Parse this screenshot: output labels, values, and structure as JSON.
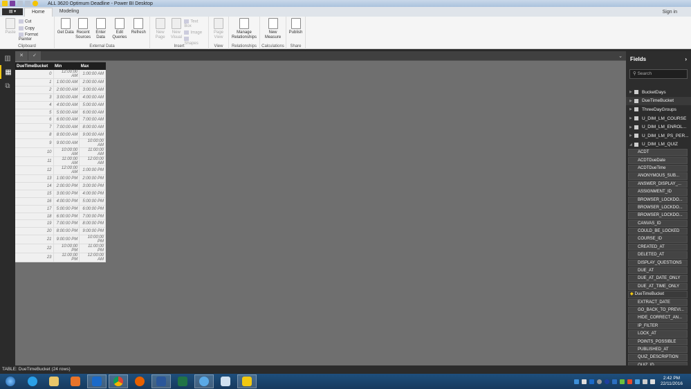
{
  "window": {
    "title": "ALL 3620 Optimum Deadline - Power BI Desktop"
  },
  "tabs": [
    {
      "label": "Home"
    },
    {
      "label": "Modeling"
    }
  ],
  "signin": "Sign in",
  "ribbon": {
    "clipboard": {
      "label": "Clipboard",
      "paste": "Paste",
      "cut": "Cut",
      "copy": "Copy",
      "format_painter": "Format Painter"
    },
    "external": {
      "label": "External Data",
      "get_data": "Get Data",
      "recent_sources": "Recent Sources",
      "enter_data": "Enter Data",
      "edit_queries": "Edit Queries",
      "refresh": "Refresh"
    },
    "insert": {
      "label": "Insert",
      "new_page": "New Page",
      "new_visual": "New Visual",
      "text_box": "Text Box",
      "image": "Image",
      "shapes": "Shapes"
    },
    "view": {
      "label": "View",
      "page_view": "Page View"
    },
    "relationships": {
      "label": "Relationships",
      "manage": "Manage Relationships"
    },
    "calculations": {
      "label": "Calculations",
      "new_measure": "New Measure"
    },
    "share": {
      "label": "Share",
      "publish": "Publish"
    }
  },
  "table": {
    "columns": [
      "DueTimeBucket",
      "Min",
      "Max"
    ],
    "rows": [
      [
        "0",
        "12:00:00 AM",
        "1:00:00 AM"
      ],
      [
        "1",
        "1:00:00 AM",
        "2:00:00 AM"
      ],
      [
        "2",
        "2:00:00 AM",
        "3:00:00 AM"
      ],
      [
        "3",
        "3:00:00 AM",
        "4:00:00 AM"
      ],
      [
        "4",
        "4:00:00 AM",
        "5:00:00 AM"
      ],
      [
        "5",
        "5:00:00 AM",
        "6:00:00 AM"
      ],
      [
        "6",
        "6:00:00 AM",
        "7:00:00 AM"
      ],
      [
        "7",
        "7:00:00 AM",
        "8:00:00 AM"
      ],
      [
        "8",
        "8:00:00 AM",
        "9:00:00 AM"
      ],
      [
        "9",
        "9:00:00 AM",
        "10:00:00 AM"
      ],
      [
        "10",
        "10:00:00 AM",
        "11:00:00 AM"
      ],
      [
        "11",
        "11:00:00 AM",
        "12:00:00 AM"
      ],
      [
        "12",
        "12:00:00 AM",
        "1:00:00 PM"
      ],
      [
        "13",
        "1:00:00 PM",
        "2:00:00 PM"
      ],
      [
        "14",
        "2:00:00 PM",
        "3:00:00 PM"
      ],
      [
        "15",
        "3:00:00 PM",
        "4:00:00 PM"
      ],
      [
        "16",
        "4:00:00 PM",
        "5:00:00 PM"
      ],
      [
        "17",
        "5:00:00 PM",
        "6:00:00 PM"
      ],
      [
        "18",
        "6:00:00 PM",
        "7:00:00 PM"
      ],
      [
        "19",
        "7:00:00 PM",
        "8:00:00 PM"
      ],
      [
        "20",
        "8:00:00 PM",
        "9:00:00 PM"
      ],
      [
        "21",
        "9:00:00 PM",
        "10:00:00 PM"
      ],
      [
        "22",
        "10:00:00 PM",
        "11:00:00 PM"
      ],
      [
        "23",
        "11:00:00 PM",
        "12:00:00 AM"
      ]
    ]
  },
  "fields": {
    "title": "Fields",
    "search_placeholder": "Search",
    "tables": [
      "BucketDays",
      "DueTimeBucket",
      "ThreeDayGroups",
      "U_DIM_LM_COURSE",
      "U_DIM_LM_ENROL...",
      "U_DIM_LM_PS_PER...",
      "U_DIM_LM_QUIZ"
    ],
    "items": [
      "ACDT",
      "ACDTDueDate",
      "ACDTDueTime",
      "ANONYMOUS_SUB...",
      "ANSWER_DISPLAY_...",
      "ASSIGNMENT_ID",
      "BROWSER_LOCKDO...",
      "BROWSER_LOCKDO...",
      "BROWSER_LOCKDO...",
      "CANVAS_ID",
      "COULD_BE_LOCKED",
      "COURSE_ID",
      "CREATED_AT",
      "DELETED_AT",
      "DISPLAY_QUESTIONS",
      "DUE_AT",
      "DUE_AT_DATE_ONLY",
      "DUE_AT_TIME_ONLY",
      "DueTimeBucket",
      "EXTRACT_DATE",
      "GO_BACK_TO_PREVI...",
      "HIDE_CORRECT_AN...",
      "IP_FILTER",
      "LOCK_AT",
      "POINTS_POSSIBLE",
      "PUBLISHED_AT",
      "QUIZ_DESCRIPTION",
      "QUIZ_ID"
    ]
  },
  "status": "TABLE: DueTimeBucket (24 rows)",
  "clock": {
    "time": "2:42 PM",
    "date": "22/11/2016"
  },
  "colors": {
    "accent": "#f2c811",
    "taskbar": "#1e4f7d"
  }
}
